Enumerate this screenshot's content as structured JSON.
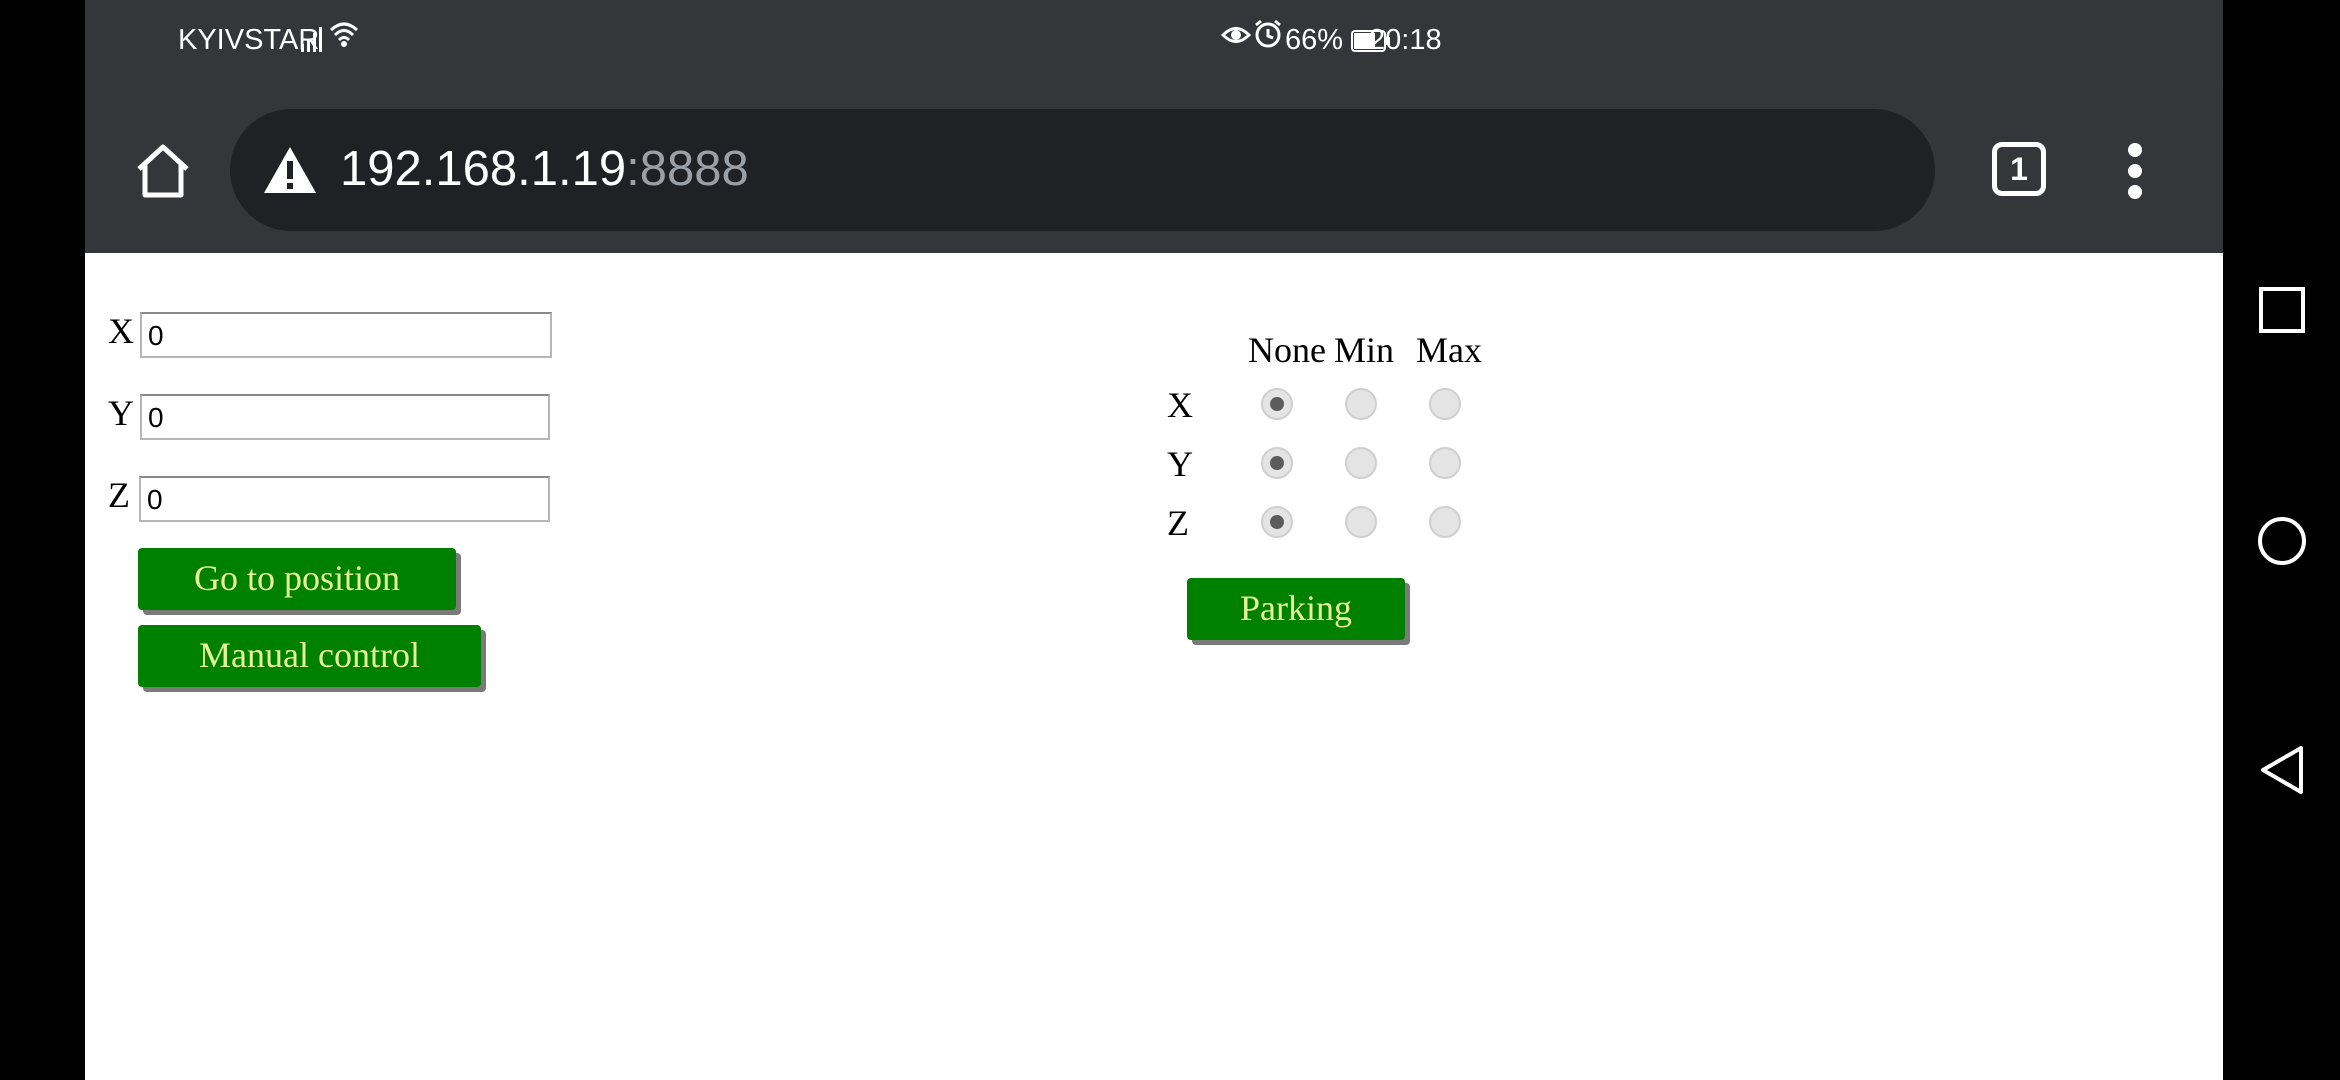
{
  "status_bar": {
    "carrier": "KYIVSTAR",
    "battery_percent": "66%",
    "time": "20:18",
    "icons": [
      "signal-icon",
      "wifi-icon",
      "eye-icon",
      "alarm-icon",
      "battery-icon"
    ]
  },
  "browser": {
    "url_host": "192.168.1.19",
    "url_port": ":8888",
    "tab_count": "1",
    "icons": [
      "home-icon",
      "warning-icon",
      "tabs-icon",
      "more-vert-icon"
    ]
  },
  "position_form": {
    "fields": [
      {
        "label": "X",
        "value": "0"
      },
      {
        "label": "Y",
        "value": "0"
      },
      {
        "label": "Z",
        "value": "0"
      }
    ],
    "go_button": "Go to position",
    "manual_button": "Manual control"
  },
  "parking": {
    "columns": [
      "None",
      "Min",
      "Max"
    ],
    "rows": [
      {
        "label": "X",
        "selected": "None"
      },
      {
        "label": "Y",
        "selected": "None"
      },
      {
        "label": "Z",
        "selected": "None"
      }
    ],
    "parking_button": "Parking"
  },
  "colors": {
    "button_bg": "#008000",
    "button_text": "#e6f59a",
    "chrome_bg": "#35363a"
  },
  "nav_bar": {
    "icons": [
      "recents-icon",
      "home-circle-icon",
      "back-icon"
    ]
  }
}
